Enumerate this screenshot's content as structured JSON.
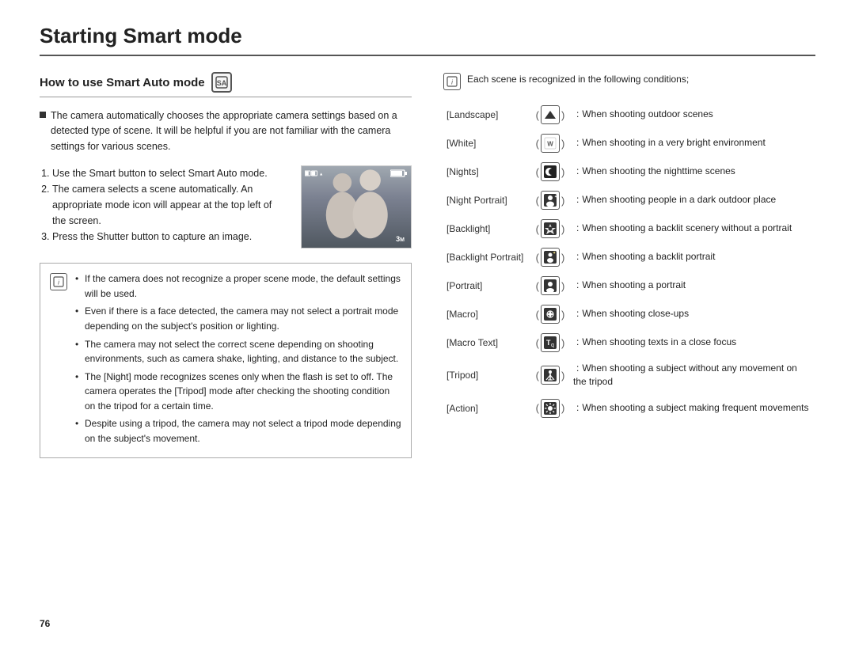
{
  "page": {
    "title": "Starting Smart mode",
    "page_number": "76"
  },
  "left": {
    "section_heading": "How to use Smart Auto mode",
    "intro_bullet": "The camera automatically chooses the appropriate camera settings based on a detected type of scene. It will be helpful if you are not familiar with the camera settings for various scenes.",
    "steps": [
      "Use the Smart button to select Smart Auto mode.",
      "The camera selects a scene automatically. An appropriate mode icon will appear at the top left of the screen.",
      "Press the Shutter button to capture an image."
    ],
    "notes": [
      "If the camera does not recognize a proper scene mode, the default settings will be used.",
      "Even if there is a face detected, the camera may not select a portrait mode depending on the subject's position or lighting.",
      "The camera may not select the correct scene depending on shooting environments, such as camera shake, lighting, and distance to the subject.",
      "The [Night] mode recognizes scenes only when the flash is set to off. The camera operates the [Tripod] mode after checking the shooting condition on the tripod for a certain time.",
      "Despite using a tripod, the camera may not select a tripod mode depending on the subject's movement."
    ]
  },
  "right": {
    "note": "Each scene is recognized in the following conditions;",
    "scenes": [
      {
        "label": "[Landscape]",
        "icon": "▲",
        "description": "When shooting outdoor scenes"
      },
      {
        "label": "[White]",
        "icon": "W",
        "description": "When shooting in a very bright environment"
      },
      {
        "label": "[Nights]",
        "icon": "☽",
        "description": "When shooting the nighttime scenes"
      },
      {
        "label": "[Night Portrait]",
        "icon": "👤✦",
        "description": "When shooting people in a dark outdoor place"
      },
      {
        "label": "[Backlight]",
        "icon": "✦👤",
        "description": "When shooting a backlit scenery without a portrait"
      },
      {
        "label": "[Backlight Portrait]",
        "icon": "✦👤",
        "description": "When shooting a backlit portrait"
      },
      {
        "label": "[Portrait]",
        "icon": "👤",
        "description": "When shooting a portrait"
      },
      {
        "label": "[Macro]",
        "icon": "✿",
        "description": "When shooting close-ups"
      },
      {
        "label": "[Macro Text]",
        "icon": "Tq",
        "description": "When shooting texts in a close focus"
      },
      {
        "label": "[Tripod]",
        "icon": "⚡",
        "description": "When shooting a subject without any movement on the tripod"
      },
      {
        "label": "[Action]",
        "icon": "❋",
        "description": "When shooting a subject making frequent movements"
      }
    ]
  }
}
